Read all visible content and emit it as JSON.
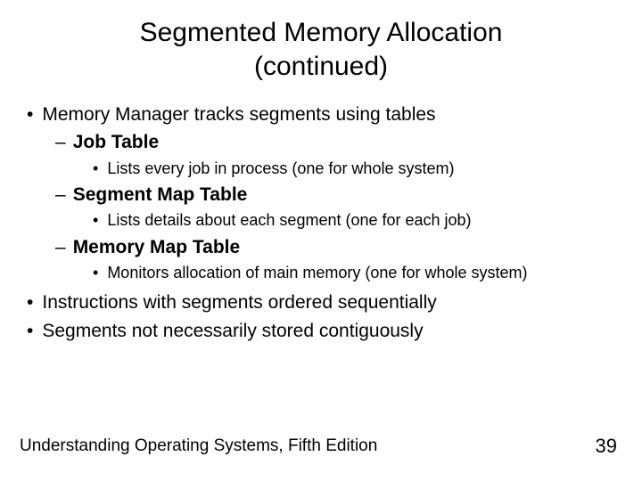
{
  "title_line1": "Segmented Memory Allocation",
  "title_line2": "(continued)",
  "bullets": {
    "l1a": "Memory Manager tracks segments using tables",
    "l2a": "Job Table",
    "l3a": "Lists every job in process (one for whole system)",
    "l2b": "Segment Map Table",
    "l3b": "Lists details about each segment (one for each job)",
    "l2c": "Memory Map Table",
    "l3c": "Monitors allocation of main memory (one for whole system)",
    "l1b": "Instructions with segments ordered sequentially",
    "l1c": "Segments not necessarily stored contiguously"
  },
  "footer": "Understanding Operating Systems, Fifth Edition",
  "page_number": "39"
}
